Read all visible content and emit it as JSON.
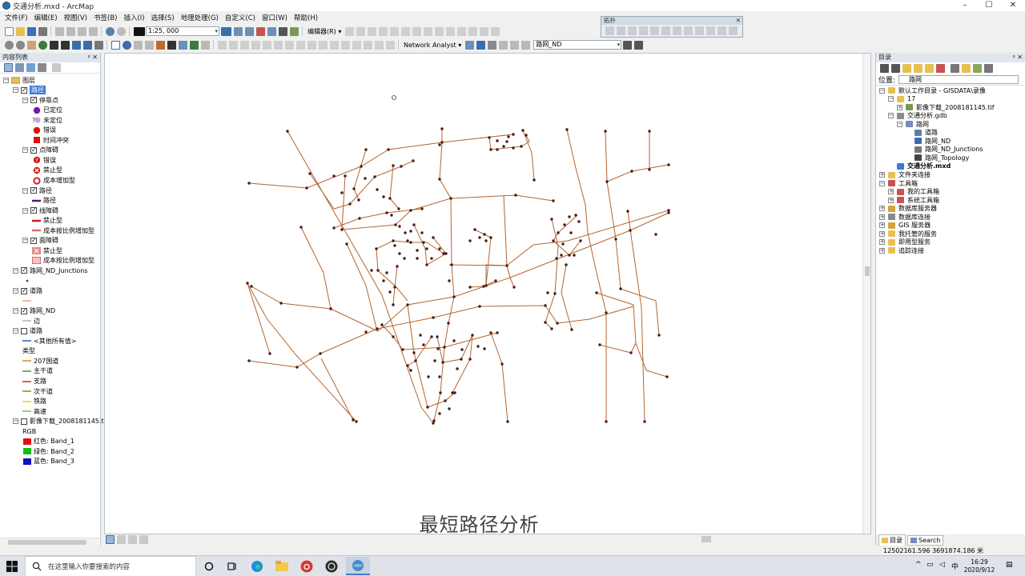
{
  "window": {
    "title": "交通分析.mxd - ArcMap",
    "controls": [
      "–",
      "☐",
      "✕"
    ]
  },
  "menu": [
    "文件(F)",
    "编辑(E)",
    "视图(V)",
    "书签(B)",
    "插入(I)",
    "选择(S)",
    "地理处理(G)",
    "自定义(C)",
    "窗口(W)",
    "帮助(H)"
  ],
  "toolbar": {
    "scale_value": "1:25, 000",
    "editor_label": "编辑器(R) ▾",
    "network_analyst_label": "Network Analyst ▾",
    "network_layer_value": "路网_ND"
  },
  "topology_toolbar": {
    "title": "拓扑"
  },
  "toc": {
    "title": "内容列表",
    "items": [
      {
        "text": "图层",
        "level": 0,
        "toggle": "−",
        "check": "",
        "sym": "layers-icon",
        "selected": false
      },
      {
        "text": "路径",
        "level": 1,
        "toggle": "−",
        "check": "✓",
        "sym": "",
        "selected": true
      },
      {
        "text": "停靠点",
        "level": 2,
        "toggle": "−",
        "check": "✓",
        "sym": "",
        "selected": false
      },
      {
        "text": "已定位",
        "level": 3,
        "toggle": "",
        "check": "",
        "sym": "purple-dot",
        "selected": false
      },
      {
        "text": "未定位",
        "level": 3,
        "toggle": "",
        "check": "",
        "sym": "unlocated-dot",
        "selected": false
      },
      {
        "text": "错误",
        "level": 3,
        "toggle": "",
        "check": "",
        "sym": "red-dot",
        "selected": false
      },
      {
        "text": "时间冲突",
        "level": 3,
        "toggle": "",
        "check": "",
        "sym": "red-square",
        "selected": false
      },
      {
        "text": "点障碍",
        "level": 2,
        "toggle": "−",
        "check": "✓",
        "sym": "",
        "selected": false
      },
      {
        "text": "错误",
        "level": 3,
        "toggle": "",
        "check": "",
        "sym": "error-barrier",
        "selected": false
      },
      {
        "text": "禁止型",
        "level": 3,
        "toggle": "",
        "check": "",
        "sym": "restrict-barrier",
        "selected": false
      },
      {
        "text": "成本增加型",
        "level": 3,
        "toggle": "",
        "check": "",
        "sym": "cost-barrier",
        "selected": false
      },
      {
        "text": "路径",
        "level": 2,
        "toggle": "−",
        "check": "✓",
        "sym": "",
        "selected": false
      },
      {
        "text": "路径",
        "level": 3,
        "toggle": "",
        "check": "",
        "sym": "route-line",
        "selected": false
      },
      {
        "text": "线障碍",
        "level": 2,
        "toggle": "−",
        "check": "✓",
        "sym": "",
        "selected": false
      },
      {
        "text": "禁止型",
        "level": 3,
        "toggle": "",
        "check": "",
        "sym": "restrict-line",
        "selected": false
      },
      {
        "text": "成本按比例增加型",
        "level": 3,
        "toggle": "",
        "check": "",
        "sym": "scaled-line",
        "selected": false
      },
      {
        "text": "面障碍",
        "level": 2,
        "toggle": "−",
        "check": "✓",
        "sym": "",
        "selected": false
      },
      {
        "text": "禁止型",
        "level": 3,
        "toggle": "",
        "check": "",
        "sym": "restrict-poly",
        "selected": false
      },
      {
        "text": "成本按比例增加型",
        "level": 3,
        "toggle": "",
        "check": "",
        "sym": "scaled-poly",
        "selected": false
      },
      {
        "text": "路网_ND_Junctions",
        "level": 1,
        "toggle": "−",
        "check": "✓",
        "sym": "",
        "selected": false
      },
      {
        "text": "",
        "level": 2,
        "toggle": "",
        "check": "",
        "sym": "small-dot",
        "selected": false
      },
      {
        "text": "道路",
        "level": 1,
        "toggle": "−",
        "check": "✓",
        "sym": "",
        "selected": false
      },
      {
        "text": "",
        "level": 2,
        "toggle": "",
        "check": "",
        "sym": "thin-line",
        "selected": false
      },
      {
        "text": "路网_ND",
        "level": 1,
        "toggle": "−",
        "check": "✓",
        "sym": "",
        "selected": false
      },
      {
        "text": "边",
        "level": 2,
        "toggle": "",
        "check": "",
        "sym": "edge-line",
        "selected": false
      },
      {
        "text": "道路",
        "level": 1,
        "toggle": "−",
        "check": "☐",
        "sym": "",
        "selected": false
      },
      {
        "text": "<其他所有值>",
        "level": 2,
        "toggle": "",
        "check": "",
        "sym": "blue-line",
        "selected": false
      },
      {
        "text": "类型",
        "level": 2,
        "toggle": "",
        "check": "",
        "sym": "",
        "selected": false
      },
      {
        "text": "207国道",
        "level": 2,
        "toggle": "",
        "check": "",
        "sym": "orange-line",
        "selected": false
      },
      {
        "text": "主干道",
        "level": 2,
        "toggle": "",
        "check": "",
        "sym": "green-line",
        "selected": false
      },
      {
        "text": "支路",
        "level": 2,
        "toggle": "",
        "check": "",
        "sym": "red-line",
        "selected": false
      },
      {
        "text": "次干道",
        "level": 2,
        "toggle": "",
        "check": "",
        "sym": "olive-line",
        "selected": false
      },
      {
        "text": "铁路",
        "level": 2,
        "toggle": "",
        "check": "",
        "sym": "yellow-line",
        "selected": false
      },
      {
        "text": "高速",
        "level": 2,
        "toggle": "",
        "check": "",
        "sym": "lime-line",
        "selected": false
      },
      {
        "text": "影像下载_2008181145.tif",
        "level": 1,
        "toggle": "−",
        "check": "☐",
        "sym": "",
        "selected": false
      },
      {
        "text": "RGB",
        "level": 2,
        "toggle": "",
        "check": "",
        "sym": "",
        "selected": false
      },
      {
        "text": "红色:    Band_1",
        "level": 2,
        "toggle": "",
        "check": "",
        "sym": "red-swatch",
        "selected": false
      },
      {
        "text": "绿色: Band_2",
        "level": 2,
        "toggle": "",
        "check": "",
        "sym": "green-swatch",
        "selected": false
      },
      {
        "text": "蓝色:  Band_3",
        "level": 2,
        "toggle": "",
        "check": "",
        "sym": "blue-swatch",
        "selected": false
      }
    ]
  },
  "map": {
    "caption": "最短路径分析",
    "road_color": "#b5652e",
    "junction_color": "#4a1a1a"
  },
  "catalog": {
    "title": "目录",
    "location_label": "位置:",
    "location_value": "路网",
    "items": [
      {
        "text": "默认工作目录 - GISDATA\\录像",
        "level": 0,
        "toggle": "−",
        "icon": "home-folder"
      },
      {
        "text": "17",
        "level": 1,
        "toggle": "−",
        "icon": "folder"
      },
      {
        "text": "影像下载_2008181145.tif",
        "level": 2,
        "toggle": "+",
        "icon": "raster"
      },
      {
        "text": "交通分析.gdb",
        "level": 1,
        "toggle": "−",
        "icon": "gdb"
      },
      {
        "text": "路网",
        "level": 2,
        "toggle": "−",
        "icon": "dataset"
      },
      {
        "text": "道路",
        "level": 3,
        "toggle": "",
        "icon": "line-fc"
      },
      {
        "text": "路网_ND",
        "level": 3,
        "toggle": "",
        "icon": "network"
      },
      {
        "text": "路网_ND_Junctions",
        "level": 3,
        "toggle": "",
        "icon": "point-fc"
      },
      {
        "text": "路网_Topology",
        "level": 3,
        "toggle": "",
        "icon": "topology"
      },
      {
        "text": "交通分析.mxd",
        "level": 1,
        "toggle": "",
        "icon": "mxd",
        "bold": true
      },
      {
        "text": "文件夹连接",
        "level": 0,
        "toggle": "+",
        "icon": "folder"
      },
      {
        "text": "工具箱",
        "level": 0,
        "toggle": "−",
        "icon": "toolbox"
      },
      {
        "text": "我的工具箱",
        "level": 1,
        "toggle": "+",
        "icon": "toolbox"
      },
      {
        "text": "系统工具箱",
        "level": 1,
        "toggle": "+",
        "icon": "toolbox"
      },
      {
        "text": "数据库服务器",
        "level": 0,
        "toggle": "+",
        "icon": "server"
      },
      {
        "text": "数据库连接",
        "level": 0,
        "toggle": "+",
        "icon": "db"
      },
      {
        "text": "GIS 服务器",
        "level": 0,
        "toggle": "+",
        "icon": "server"
      },
      {
        "text": "我托管的服务",
        "level": 0,
        "toggle": "+",
        "icon": "folder"
      },
      {
        "text": "即用型服务",
        "level": 0,
        "toggle": "+",
        "icon": "folder"
      },
      {
        "text": "追踪连接",
        "level": 0,
        "toggle": "+",
        "icon": "folder"
      }
    ],
    "tabs": [
      "目录",
      "Search"
    ]
  },
  "status": {
    "coords": "12502161.596  3691874.186 米"
  },
  "taskbar": {
    "search_placeholder": "在这里输入你要搜索的内容",
    "time": "16:29",
    "date": "2020/9/12",
    "ime": "中"
  }
}
